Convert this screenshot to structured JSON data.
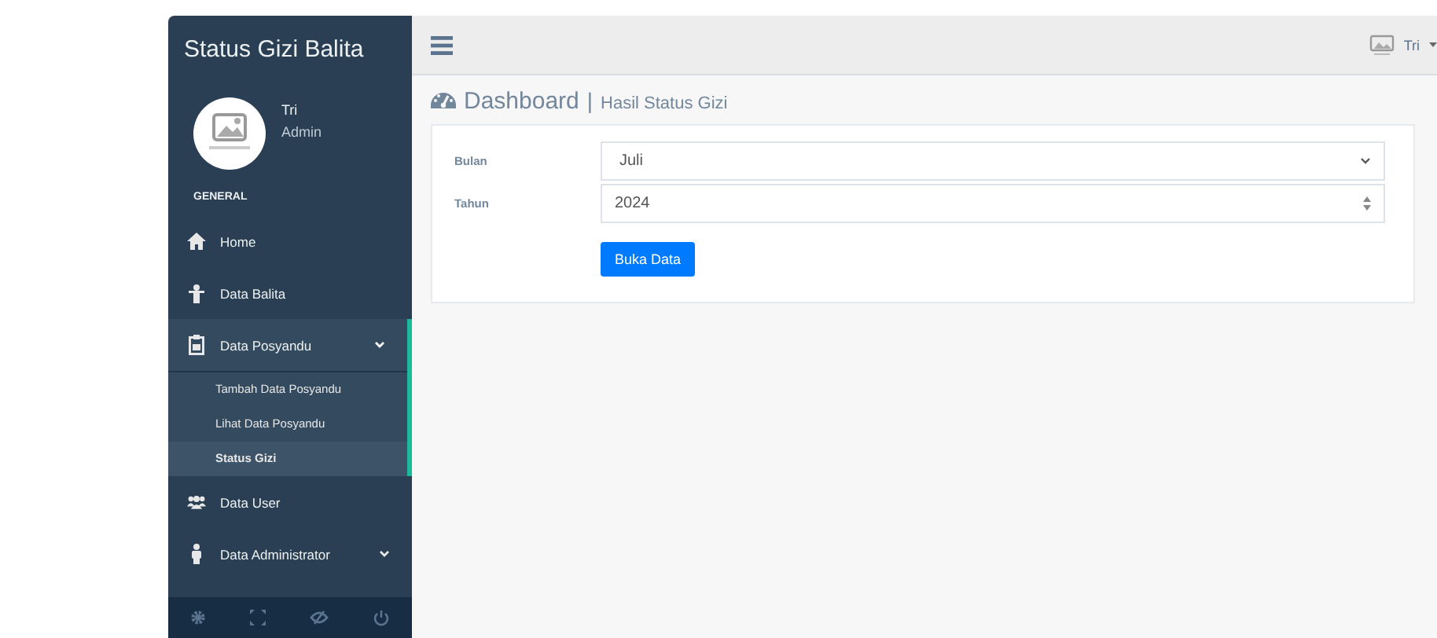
{
  "sidebar": {
    "title": "Status Gizi Balita",
    "profile": {
      "name": "Tri",
      "role": "Admin"
    },
    "section": "GENERAL",
    "items": [
      {
        "label": "Home"
      },
      {
        "label": "Data Balita"
      },
      {
        "label": "Data Posyandu",
        "expanded": true,
        "children": [
          {
            "label": "Tambah Data Posyandu",
            "selected": false
          },
          {
            "label": "Lihat Data Posyandu",
            "selected": false
          },
          {
            "label": "Status Gizi",
            "selected": true
          }
        ]
      },
      {
        "label": "Data User"
      },
      {
        "label": "Data Administrator",
        "expanded": false
      }
    ]
  },
  "topbar": {
    "user": "Tri"
  },
  "page": {
    "title": "Dashboard",
    "separator": "|",
    "subtitle": "Hasil Status Gizi"
  },
  "form": {
    "fields": [
      {
        "label": "Bulan",
        "kind": "select",
        "value": "Juli"
      },
      {
        "label": "Tahun",
        "kind": "number",
        "value": "2024"
      }
    ],
    "button": "Buka Data"
  }
}
